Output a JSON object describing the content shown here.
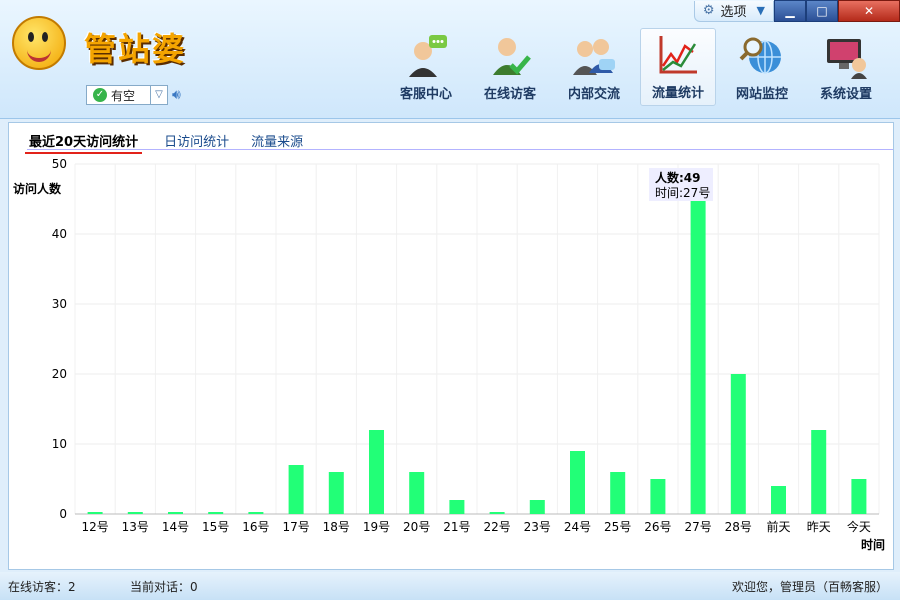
{
  "app": {
    "logo_text": "管站婆"
  },
  "window": {
    "options_label": "选项",
    "min": "▁",
    "max": "□",
    "close": "✕"
  },
  "status": {
    "label": "有空"
  },
  "nav": [
    {
      "label": "客服中心",
      "icon": "customer-service-icon"
    },
    {
      "label": "在线访客",
      "icon": "online-visitor-icon"
    },
    {
      "label": "内部交流",
      "icon": "internal-chat-icon"
    },
    {
      "label": "流量统计",
      "icon": "traffic-stats-icon",
      "active": true
    },
    {
      "label": "网站监控",
      "icon": "site-monitor-icon"
    },
    {
      "label": "系统设置",
      "icon": "system-settings-icon"
    }
  ],
  "tabs": [
    {
      "label": "最近20天访问统计",
      "active": true
    },
    {
      "label": "日访问统计"
    },
    {
      "label": "流量来源"
    }
  ],
  "tooltip": {
    "people": "人数:49",
    "time": "时间:27号"
  },
  "chart_data": {
    "type": "bar",
    "ylabel": "访问人数",
    "xlabel": "时间",
    "ylim": [
      0,
      50
    ],
    "yticks": [
      0,
      10,
      20,
      30,
      40,
      50
    ],
    "grid": true,
    "bar_color": "#22ff77",
    "categories": [
      "12号",
      "13号",
      "14号",
      "15号",
      "16号",
      "17号",
      "18号",
      "19号",
      "20号",
      "21号",
      "22号",
      "23号",
      "24号",
      "25号",
      "26号",
      "27号",
      "28号",
      "前天",
      "昨天",
      "今天"
    ],
    "values": [
      0,
      0,
      0,
      0,
      0,
      7,
      6,
      12,
      6,
      2,
      0,
      2,
      9,
      6,
      5,
      49,
      20,
      4,
      12,
      5
    ]
  },
  "statusbar": {
    "online_visitors": "在线访客：2",
    "current_sessions": "当前对话：0",
    "welcome": "欢迎您，管理员（百畅客服）"
  }
}
